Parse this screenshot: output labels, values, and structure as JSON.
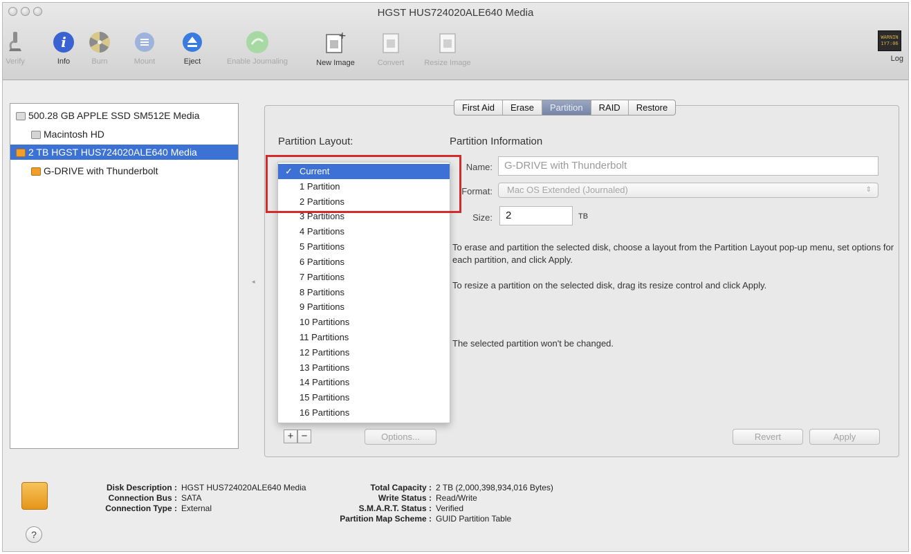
{
  "window": {
    "title": "HGST HUS724020ALE640 Media"
  },
  "toolbar": {
    "items": [
      {
        "label": "Verify",
        "icon": "microscope-icon",
        "enabled": false
      },
      {
        "label": "Info",
        "icon": "info-icon",
        "enabled": true
      },
      {
        "label": "Burn",
        "icon": "burn-icon",
        "enabled": false
      },
      {
        "label": "Mount",
        "icon": "mount-icon",
        "enabled": false
      },
      {
        "label": "Eject",
        "icon": "eject-icon",
        "enabled": true
      },
      {
        "label": "Enable Journaling",
        "icon": "journaling-icon",
        "enabled": false
      },
      {
        "label": "New Image",
        "icon": "new-image-icon",
        "enabled": true
      },
      {
        "label": "Convert",
        "icon": "convert-icon",
        "enabled": false
      },
      {
        "label": "Resize Image",
        "icon": "resize-image-icon",
        "enabled": false
      }
    ],
    "log_label": "Log",
    "log_icon_text": "WARNIN\n1Y7:06"
  },
  "sidebar": {
    "items": [
      {
        "label": "500.28 GB APPLE SSD SM512E Media",
        "level": 0,
        "selected": false
      },
      {
        "label": "Macintosh HD",
        "level": 1,
        "selected": false
      },
      {
        "label": "2 TB HGST HUS724020ALE640 Media",
        "level": 0,
        "selected": true
      },
      {
        "label": "G-DRIVE with Thunderbolt",
        "level": 1,
        "selected": false
      }
    ]
  },
  "tabs": [
    {
      "label": "First Aid",
      "active": false
    },
    {
      "label": "Erase",
      "active": false
    },
    {
      "label": "Partition",
      "active": true
    },
    {
      "label": "RAID",
      "active": false
    },
    {
      "label": "Restore",
      "active": false
    }
  ],
  "partition": {
    "layout_label": "Partition Layout:",
    "info_label": "Partition Information",
    "layout_options": [
      "Current",
      "1 Partition",
      "2 Partitions",
      "3 Partitions",
      "4 Partitions",
      "5 Partitions",
      "6 Partitions",
      "7 Partitions",
      "8 Partitions",
      "9 Partitions",
      "10 Partitions",
      "11 Partitions",
      "12 Partitions",
      "13 Partitions",
      "14 Partitions",
      "15 Partitions",
      "16 Partitions"
    ],
    "selected_option": "Current",
    "check_mark": "✓",
    "name_label": "Name:",
    "name_value": "G-DRIVE with Thunderbolt",
    "format_label": "Format:",
    "format_value": "Mac OS Extended (Journaled)",
    "size_label": "Size:",
    "size_value": "2",
    "size_unit": "TB",
    "info_text_1": "To erase and partition the selected disk, choose a layout from the Partition Layout pop-up menu, set options for each partition, and click Apply.",
    "info_text_2": "To resize a partition on the selected disk, drag its resize control and click Apply.",
    "info_text_3": "The selected partition won't be changed.",
    "add_label": "+",
    "remove_label": "−",
    "options_label": "Options...",
    "revert_label": "Revert",
    "apply_label": "Apply"
  },
  "disk_info": {
    "left": [
      {
        "key": "Disk Description :",
        "value": "HGST HUS724020ALE640 Media"
      },
      {
        "key": "Connection Bus :",
        "value": "SATA"
      },
      {
        "key": "Connection Type :",
        "value": "External"
      }
    ],
    "right": [
      {
        "key": "Total Capacity :",
        "value": "2 TB (2,000,398,934,016 Bytes)"
      },
      {
        "key": "Write Status :",
        "value": "Read/Write"
      },
      {
        "key": "S.M.A.R.T. Status :",
        "value": "Verified"
      },
      {
        "key": "Partition Map Scheme :",
        "value": "GUID Partition Table"
      }
    ],
    "help_label": "?"
  },
  "colors": {
    "selection": "#3c72d3",
    "highlight_box": "#d32a2a"
  }
}
